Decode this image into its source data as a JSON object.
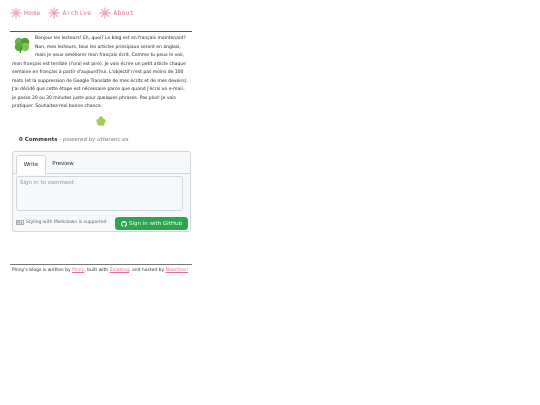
{
  "nav": {
    "items": [
      {
        "label": "Home",
        "icon": "asterisk-icon"
      },
      {
        "label": "Archive",
        "icon": "asterisk-icon"
      },
      {
        "label": "About",
        "icon": "asterisk-icon"
      }
    ],
    "accent": "#e0708a"
  },
  "post": {
    "body": "Bonjour les lecteurs! Eh, quoi? Le blog est en français maintenant? Non, mes lecteurs, tous les articles principaux seront en anglais, mais je veux améliorer mon français écrit. Comme tu peux le voir, mon français est terrible (l'oral est pire). Je vais écrire un petit article chaque semaine en français à partir d'aujourd'hui. L'objectif n'est pas moins de 100 mots (et la suppression de Google Translate de mes écrits et de mes devoirs). J'ai décidé que cette étape est nécessaire parce que quand j'écris un e-mail.. je passe 20 ou 30 minutes juste pour quelques phrases. Pas plus! Je vais pratiquer. Souhaitez-moi bonne chance."
  },
  "comments": {
    "count": "0 Comments",
    "powered": " - powered by utteranc.es",
    "tab_write": "Write",
    "tab_preview": "Preview",
    "placeholder": "Sign in to comment",
    "markdown_note": "Styling with Markdown is supported",
    "signin_label": "Sign in with GitHub",
    "button_color": "#2da44e"
  },
  "footer": {
    "prefix": "Pinny's blogs is written by ",
    "author": "Pinny",
    "mid": ", built with ",
    "tool": "Zola",
    "sep": "Zola",
    "tool2": "Zolablog",
    "mid2": ", and hosted by ",
    "host": "Neocities!"
  }
}
